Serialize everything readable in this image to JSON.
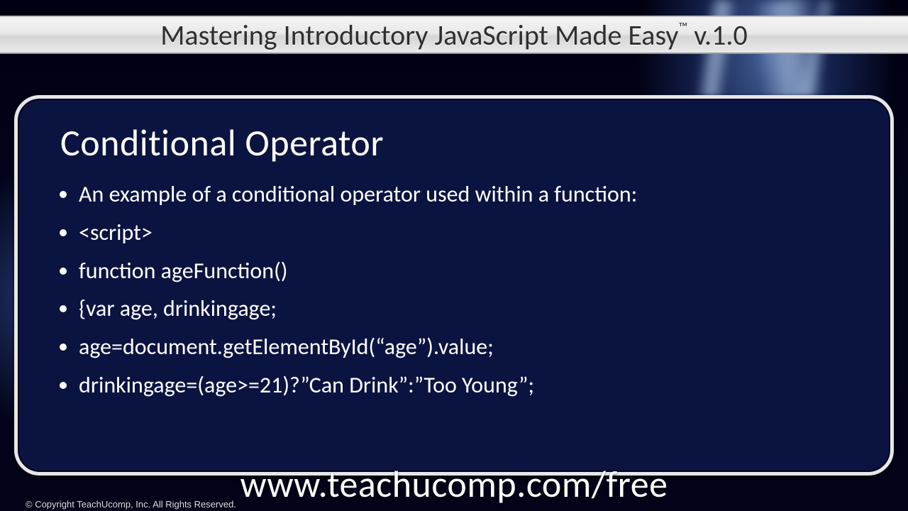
{
  "header": {
    "title_main": "Mastering Introductory JavaScript Made Easy",
    "title_tm": "™",
    "title_version": " v.1.0"
  },
  "slide": {
    "heading": "Conditional Operator",
    "bullets": [
      "An example of a conditional operator used within a function:",
      "<script>",
      "function ageFunction()",
      "{var age, drinkingage;",
      "age=document.getElementById(“age”).value;",
      "drinkingage=(age>=21)?”Can Drink”:”Too Young”;"
    ]
  },
  "footer": {
    "url": "www.teachucomp.com/free",
    "copyright": "© Copyright TeachUcomp, Inc. All Rights Reserved."
  }
}
